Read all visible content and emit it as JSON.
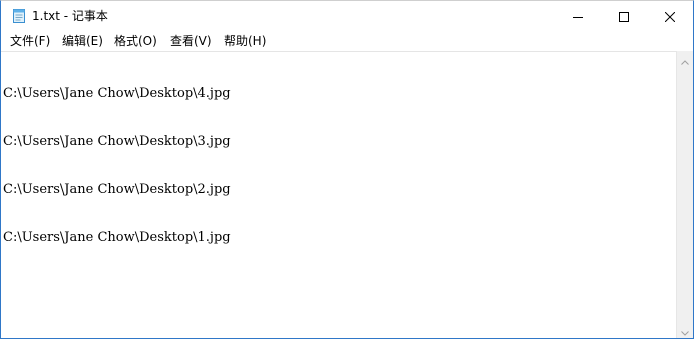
{
  "window": {
    "title": "1.txt - 记事本",
    "icon": "notepad-icon",
    "controls": {
      "minimize_icon": "minimize-icon",
      "maximize_icon": "maximize-icon",
      "close_icon": "close-icon"
    }
  },
  "menubar": {
    "items": [
      {
        "label": "文件(F)"
      },
      {
        "label": "编辑(E)"
      },
      {
        "label": "格式(O)"
      },
      {
        "label": "查看(V)"
      },
      {
        "label": "帮助(H)"
      }
    ]
  },
  "editor": {
    "lines": [
      "C:\\Users\\Jane Chow\\Desktop\\4.jpg",
      "C:\\Users\\Jane Chow\\Desktop\\3.jpg",
      "C:\\Users\\Jane Chow\\Desktop\\2.jpg",
      "C:\\Users\\Jane Chow\\Desktop\\1.jpg"
    ]
  },
  "colors": {
    "border_accent": "#2f77c8",
    "background": "#ffffff",
    "scrollbar": "#f0f0f0"
  }
}
